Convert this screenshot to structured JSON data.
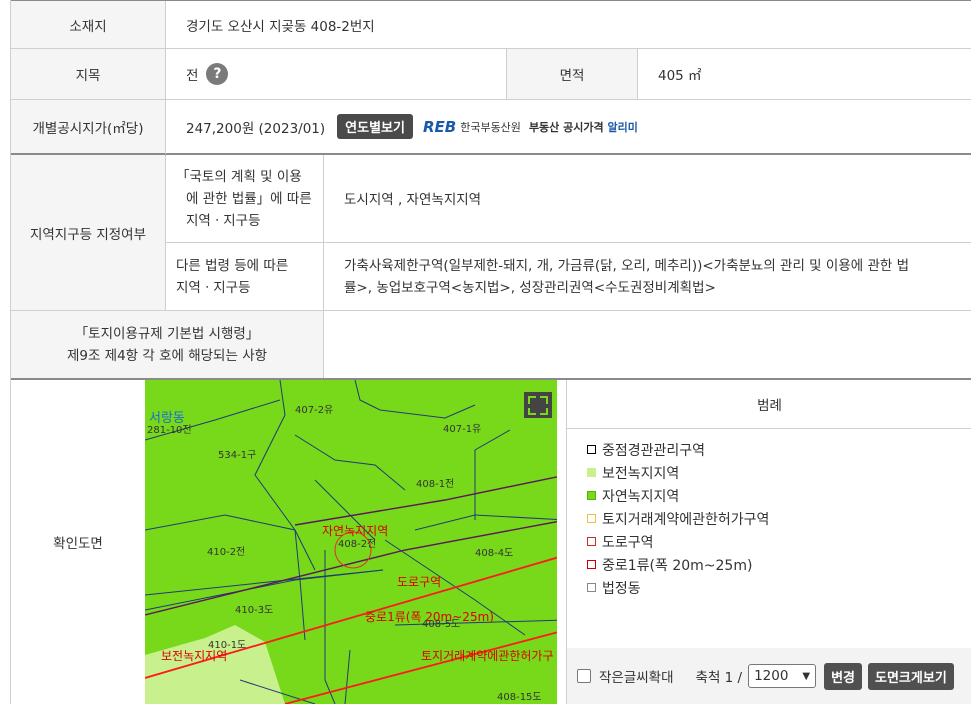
{
  "rows": {
    "location": {
      "label": "소재지",
      "value": "경기도 오산시 지곶동 408-2번지"
    },
    "land_category": {
      "label": "지목",
      "value": "전",
      "help_icon": "?"
    },
    "area": {
      "label": "면적",
      "value": "405 ㎡"
    },
    "official_price": {
      "label": "개별공시지가(㎡당)",
      "value": "247,200원 (2023/01)",
      "button": "연도별보기",
      "logo": {
        "mark": "REB",
        "org": "한국부동산원",
        "service_prefix": "부동산 공시가격",
        "service_suffix": "알리미"
      }
    },
    "zoning": {
      "label": "지역지구등 지정여부",
      "sub1": {
        "label_lines": [
          "「국토의 계획 및 이용",
          "에 관한 법률」에 따른",
          "지역ㆍ지구등"
        ],
        "value": "도시지역 , 자연녹지지역"
      },
      "sub2": {
        "label_lines": [
          "다른 법령 등에 따른",
          "지역ㆍ지구등"
        ],
        "value_lines": [
          "가축사육제한구역(일부제한-돼지, 개, 가금류(닭, 오리, 메추리))<가축분뇨의 관리 및 이용에 관한 법",
          "률>, 농업보호구역<농지법>, 성장관리권역<수도권정비계획법>"
        ]
      }
    },
    "decree": {
      "label_lines": [
        "「토지이용규제 기본법 시행령」",
        "제9조 제4항 각 호에 해당되는 사항"
      ],
      "value": ""
    },
    "map_row": {
      "label": "확인도면"
    }
  },
  "map": {
    "labels": [
      "서랑동",
      "281-10전",
      "407-2유",
      "407-1유",
      "534-1구",
      "408-1전",
      "자연녹지지역",
      "408-2전",
      "410-2전",
      "408-4도",
      "도로구역",
      "410-3도",
      "중로1류(폭 20m~25m)",
      "408-5도",
      "410-1도",
      "보전녹지지역",
      "토지거래계약에관한허가구",
      "408-15도"
    ],
    "colors": {
      "natural_green": "#77d919",
      "preserve_green": "#c8f08c",
      "road_line": "#ff1a1a",
      "parcel_line": "#1f3b7a"
    }
  },
  "legend": {
    "title": "범례",
    "items": [
      {
        "label": "중점경관관리구역",
        "fill": "#ffffff",
        "border": "#000000"
      },
      {
        "label": "보전녹지지역",
        "fill": "#c8f08c",
        "border": "#c8f08c"
      },
      {
        "label": "자연녹지지역",
        "fill": "#77d919",
        "border": "#4fb010"
      },
      {
        "label": "토지거래계약에관한허가구역",
        "fill": "#ffffff",
        "border": "#f0c040"
      },
      {
        "label": "도로구역",
        "fill": "#ffffff",
        "border": "#c03030"
      },
      {
        "label": "중로1류(폭 20m~25m)",
        "fill": "#ffffff",
        "border": "#cc0000"
      },
      {
        "label": "법정동",
        "fill": "#ffffff",
        "border": "#888888"
      }
    ],
    "footer": {
      "zoom_text": "작은글씨확대",
      "scale_label": "축척 1 /",
      "scale_value": "1200",
      "change_button": "변경",
      "big_view_button": "도면크게보기"
    }
  }
}
